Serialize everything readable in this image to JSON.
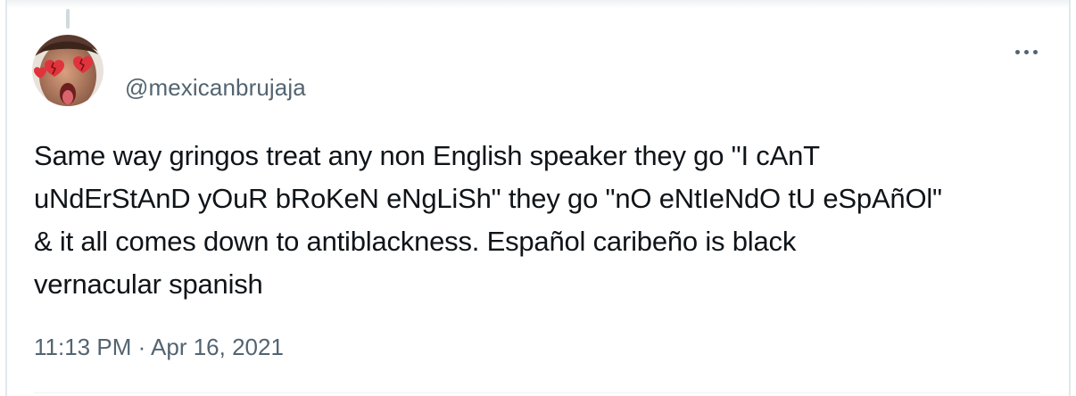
{
  "tweet": {
    "username": "@mexicanbrujaja",
    "text": "Same way gringos treat any non English speaker they go \"I cAnT\nuNdErStAnD yOuR bRoKeN eNgLiSh\" they go \"nO eNtIeNdO tU eSpAñOl\"\n& it all comes down to antiblackness. Español caribeño is black\nvernacular spanish",
    "timestamp": "11:13 PM · Apr 16, 2021"
  },
  "icons": {
    "more": "more-horizontal-icon",
    "avatar": "profile-photo-with-broken-heart-emojis"
  }
}
